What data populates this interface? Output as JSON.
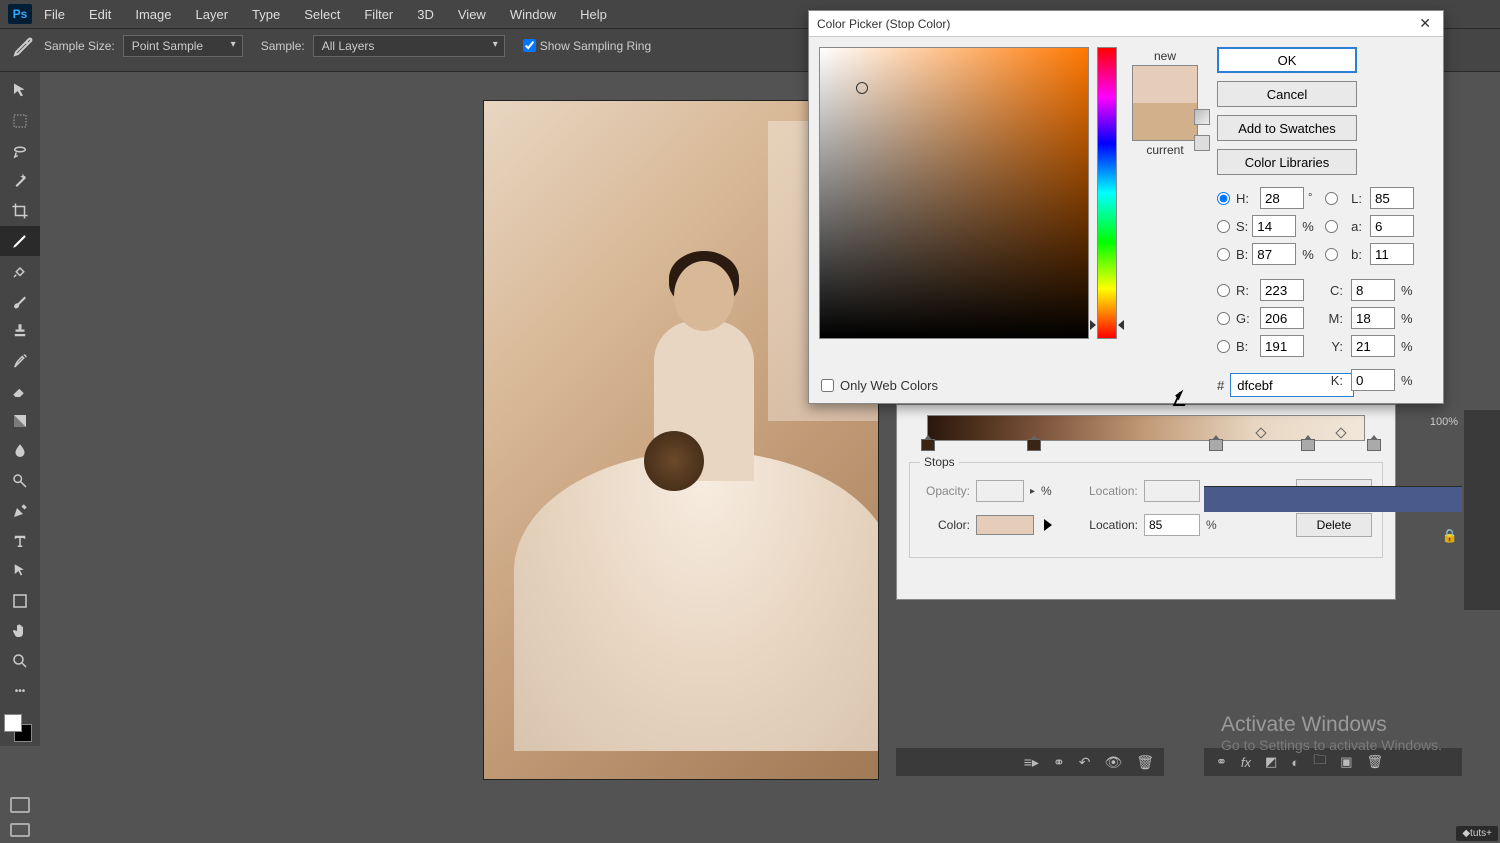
{
  "menubar": [
    "File",
    "Edit",
    "Image",
    "Layer",
    "Type",
    "Select",
    "Filter",
    "3D",
    "View",
    "Window",
    "Help"
  ],
  "optbar": {
    "sample_size_label": "Sample Size:",
    "sample_size_value": "Point Sample",
    "sample_label": "Sample:",
    "sample_value": "All Layers",
    "show_ring": "Show Sampling Ring"
  },
  "picker": {
    "title": "Color Picker (Stop Color)",
    "new": "new",
    "current": "current",
    "ok": "OK",
    "cancel": "Cancel",
    "add": "Add to Swatches",
    "libs": "Color Libraries",
    "only_web": "Only Web Colors",
    "new_color": "#e6cdb9",
    "current_color": "#d3b08c",
    "H": "28",
    "S": "14",
    "B": "87",
    "L": "85",
    "a": "6",
    "b_lab": "11",
    "R": "223",
    "G": "206",
    "Bb": "191",
    "C": "8",
    "M": "18",
    "Y": "21",
    "K": "0",
    "hex": "dfcebf",
    "hash": "#",
    "deg": "°",
    "pct": "%"
  },
  "grad": {
    "stops_label": "Stops",
    "opacity": "Opacity:",
    "location": "Location:",
    "color": "Color:",
    "loc_val": "85",
    "delete": "Delete",
    "pct": "%"
  },
  "winact": {
    "t1": "Activate Windows",
    "t2": "Go to Settings to activate Windows."
  },
  "rpanel_pct": "100%",
  "tuts": "◆tuts+"
}
